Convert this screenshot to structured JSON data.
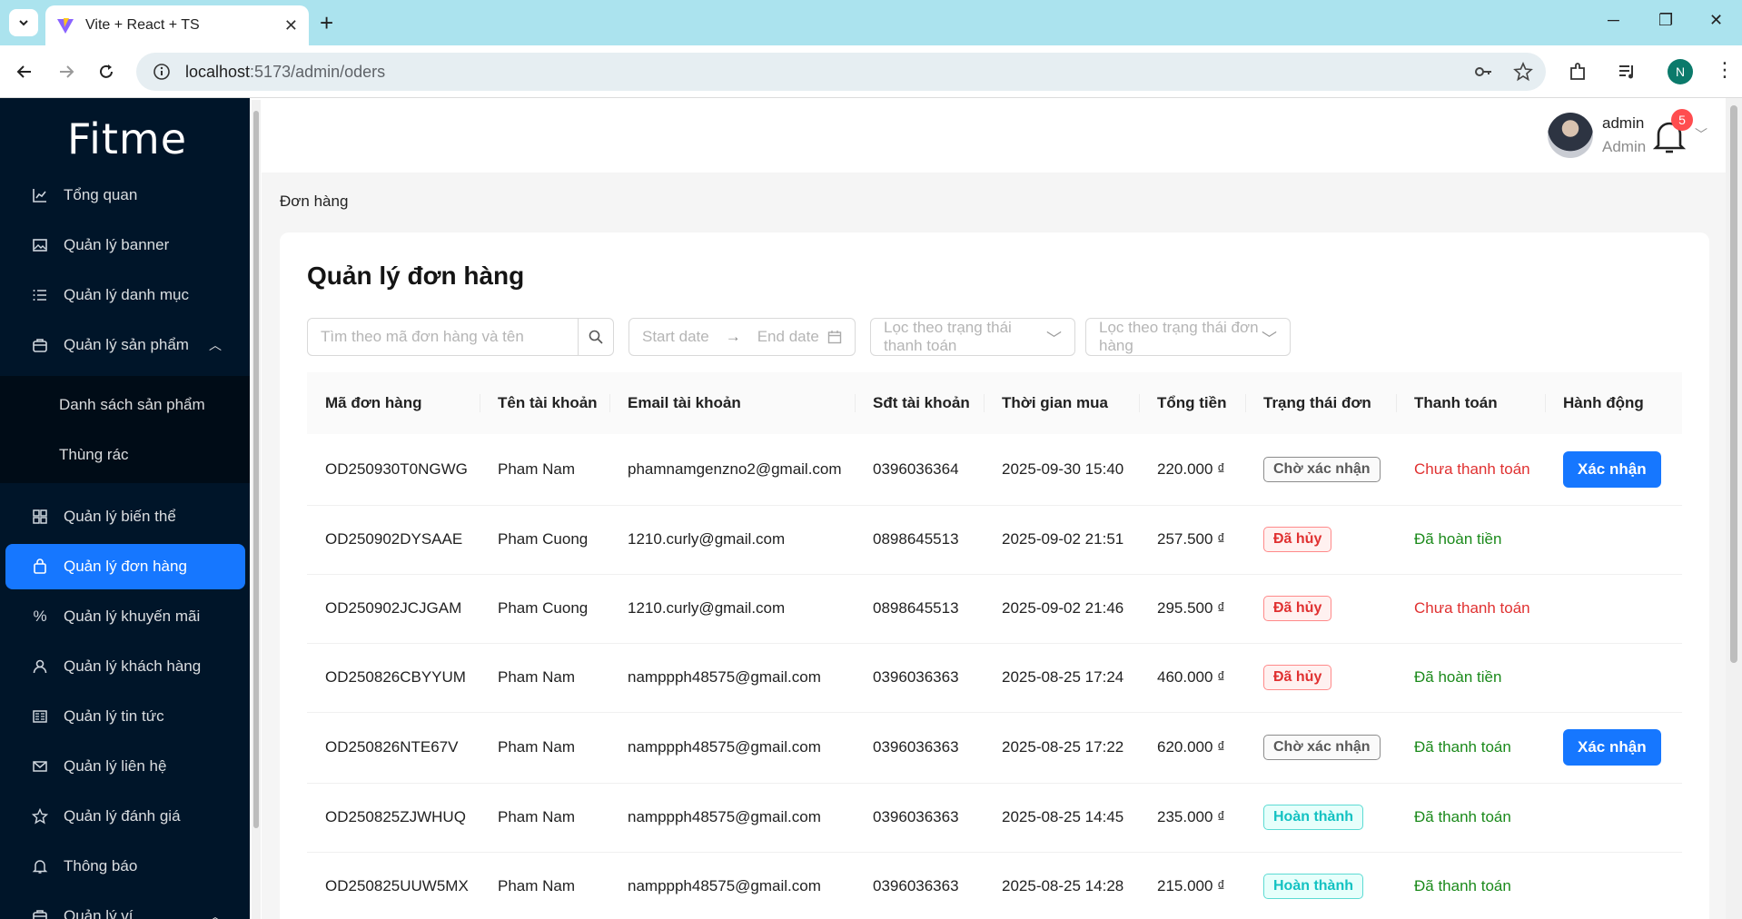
{
  "browser": {
    "tab_title": "Vite + React + TS",
    "url_host": "localhost",
    "url_path": ":5173/admin/oders",
    "profile_initial": "N"
  },
  "sidebar": {
    "logo": "Fitme",
    "items": [
      {
        "label": "Tổng quan",
        "icon": "chart-icon"
      },
      {
        "label": "Quản lý banner",
        "icon": "image-icon"
      },
      {
        "label": "Quản lý danh mục",
        "icon": "list-icon"
      },
      {
        "label": "Quản lý sản phẩm",
        "icon": "box-icon"
      },
      {
        "label": "Quản lý biến thể",
        "icon": "grid-icon"
      },
      {
        "label": "Quản lý đơn hàng",
        "icon": "bag-icon"
      },
      {
        "label": "Quản lý khuyến mãi",
        "icon": "percent-icon"
      },
      {
        "label": "Quản lý khách hàng",
        "icon": "user-icon"
      },
      {
        "label": "Quản lý tin tức",
        "icon": "news-icon"
      },
      {
        "label": "Quản lý liên hệ",
        "icon": "mail-icon"
      },
      {
        "label": "Quản lý đánh giá",
        "icon": "star-icon"
      },
      {
        "label": "Thông báo",
        "icon": "bell-icon"
      },
      {
        "label": "Quản lý ví",
        "icon": "wallet-icon"
      }
    ],
    "sub_items": [
      "Danh sách sản phẩm",
      "Thùng rác"
    ]
  },
  "header": {
    "user_name": "admin",
    "user_role": "Admin",
    "notification_count": "5"
  },
  "breadcrumb": "Đơn hàng",
  "page_title": "Quản lý đơn hàng",
  "filters": {
    "search_placeholder": "Tìm theo mã đơn hàng và tên",
    "start_date": "Start date",
    "end_date": "End date",
    "payment_status_placeholder": "Lọc theo trạng thái thanh toán",
    "order_status_placeholder": "Lọc theo trạng thái đơn hàng"
  },
  "table": {
    "columns": [
      "Mã đơn hàng",
      "Tên tài khoản",
      "Email tài khoản",
      "Sđt tài khoản",
      "Thời gian mua",
      "Tổng tiền",
      "Trạng thái đơn",
      "Thanh toán",
      "Hành động"
    ],
    "rows": [
      {
        "code": "OD250930T0NGWG",
        "name": "Pham Nam",
        "email": "phamnamgenzno2@gmail.com",
        "phone": "0396036364",
        "time": "2025-09-30 15:40",
        "total": "220.000 ₫",
        "status": "Chờ xác nhận",
        "payment": "Chưa thanh toán",
        "action": "Xác nhận"
      },
      {
        "code": "OD250902DYSAAE",
        "name": "Pham Cuong",
        "email": "1210.curly@gmail.com",
        "phone": "0898645513",
        "time": "2025-09-02 21:51",
        "total": "257.500 ₫",
        "status": "Đã hủy",
        "payment": "Đã hoàn tiền",
        "action": ""
      },
      {
        "code": "OD250902JCJGAM",
        "name": "Pham Cuong",
        "email": "1210.curly@gmail.com",
        "phone": "0898645513",
        "time": "2025-09-02 21:46",
        "total": "295.500 ₫",
        "status": "Đã hủy",
        "payment": "Chưa thanh toán",
        "action": ""
      },
      {
        "code": "OD250826CBYYUM",
        "name": "Pham Nam",
        "email": "namppph48575@gmail.com",
        "phone": "0396036363",
        "time": "2025-08-25 17:24",
        "total": "460.000 ₫",
        "status": "Đã hủy",
        "payment": "Đã hoàn tiền",
        "action": ""
      },
      {
        "code": "OD250826NTE67V",
        "name": "Pham Nam",
        "email": "namppph48575@gmail.com",
        "phone": "0396036363",
        "time": "2025-08-25 17:22",
        "total": "620.000 ₫",
        "status": "Chờ xác nhận",
        "payment": "Đã thanh toán",
        "action": "Xác nhận"
      },
      {
        "code": "OD250825ZJWHUQ",
        "name": "Pham Nam",
        "email": "namppph48575@gmail.com",
        "phone": "0396036363",
        "time": "2025-08-25 14:45",
        "total": "235.000 ₫",
        "status": "Hoàn thành",
        "payment": "Đã thanh toán",
        "action": ""
      },
      {
        "code": "OD250825UUW5MX",
        "name": "Pham Nam",
        "email": "namppph48575@gmail.com",
        "phone": "0396036363",
        "time": "2025-08-25 14:28",
        "total": "215.000 ₫",
        "status": "Hoàn thành",
        "payment": "Đã thanh toán",
        "action": ""
      }
    ]
  },
  "colors": {
    "primary": "#1677ff",
    "sidebar_bg": "#001529",
    "danger": "#e03131",
    "success": "#1b8a1b",
    "done": "#13c2c2"
  }
}
